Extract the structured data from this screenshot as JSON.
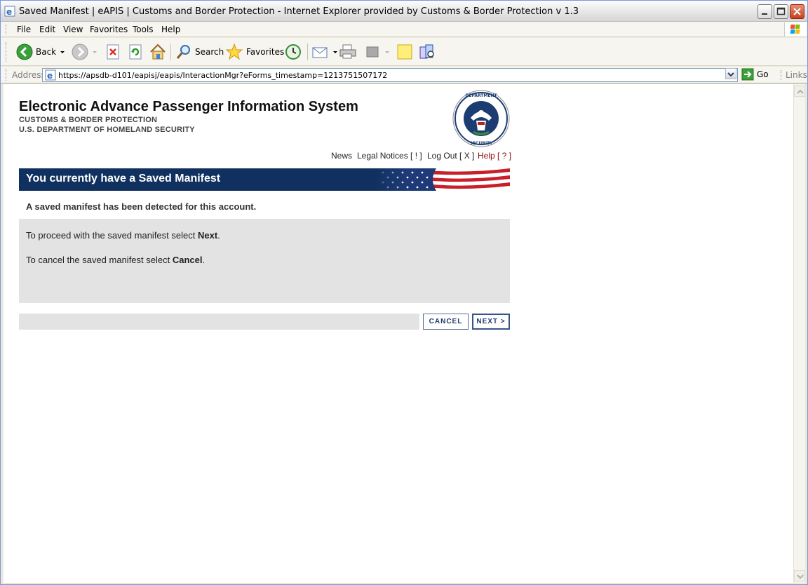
{
  "window": {
    "title": "Saved Manifest | eAPIS | Customs and Border Protection - Internet Explorer provided by Customs & Border Protection v 1.3"
  },
  "menu": {
    "items": [
      {
        "label": "File"
      },
      {
        "label": "Edit"
      },
      {
        "label": "View"
      },
      {
        "label": "Favorites"
      },
      {
        "label": "Tools"
      },
      {
        "label": "Help"
      }
    ]
  },
  "toolbar": {
    "back_label": "Back",
    "search_label": "Search",
    "favorites_label": "Favorites"
  },
  "address": {
    "label": "Address",
    "url": "https://apsdb-d101/eapisj/eapis/InteractionMgr?eForms_timestamp=1213751507172",
    "go_label": "Go",
    "links_label": "Links"
  },
  "page": {
    "app_title": "Electronic Advance Passenger Information System",
    "agency_line1": "CUSTOMS & BORDER PROTECTION",
    "agency_line2": "U.S. DEPARTMENT OF HOMELAND SECURITY",
    "top_links": {
      "news": "News",
      "legal": "Legal Notices [ ! ]",
      "logout": "Log Out [ X ]",
      "help": "Help [ ? ]"
    },
    "banner_title": "You currently have a Saved Manifest",
    "detected_message": "A saved manifest has been detected for this account.",
    "proceed_prefix": "To proceed with the saved manifest select ",
    "proceed_action": "Next",
    "cancel_prefix": "To cancel the saved manifest select ",
    "cancel_action": "Cancel",
    "period": ".",
    "cancel_button": "CANCEL",
    "next_button": "NEXT >"
  },
  "seal": {
    "text": "U.S. DEPARTMENT OF HOMELAND SECURITY"
  }
}
